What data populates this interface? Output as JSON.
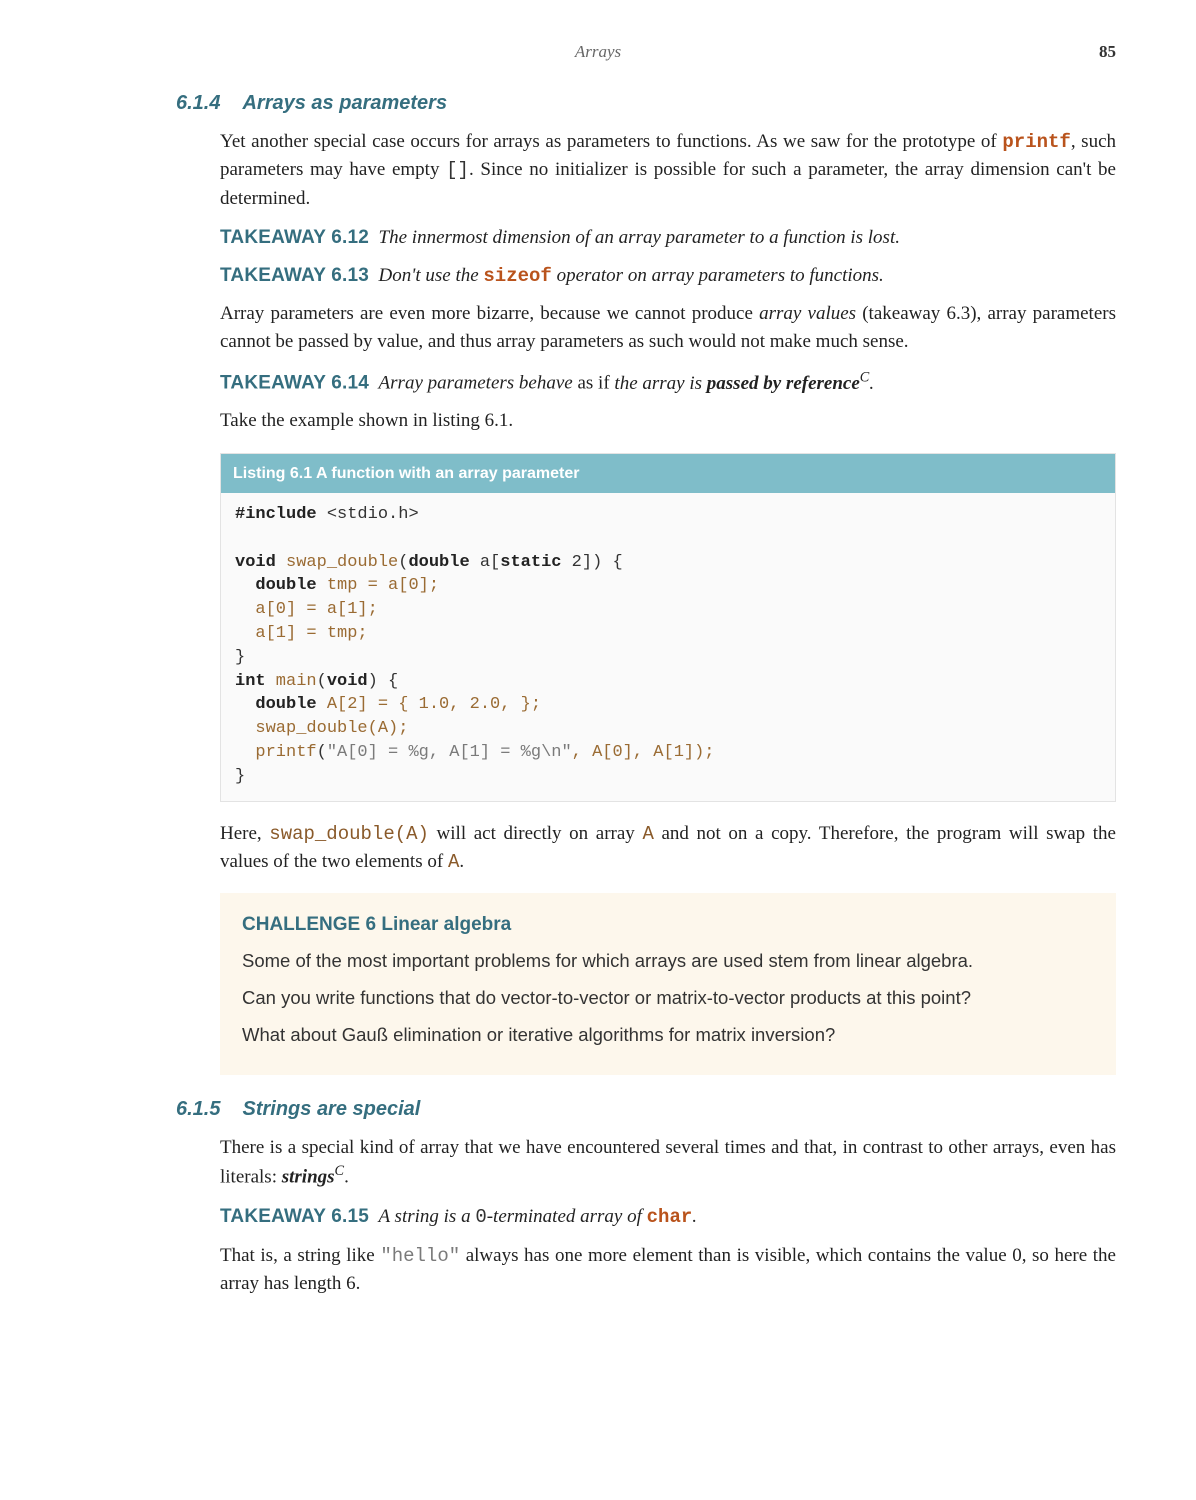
{
  "header": {
    "title": "Arrays",
    "page_number": "85"
  },
  "section1": {
    "num": "6.1.4",
    "title": "Arrays as parameters"
  },
  "p1a": "Yet another special case occurs for arrays as parameters to functions.  As we saw for the prototype of ",
  "p1_printf": "printf",
  "p1b": ", such parameters may have empty ",
  "p1_brackets": "[]",
  "p1c": ".  Since no initializer is possible for such a parameter, the array dimension can't be determined.",
  "tw612": {
    "label": "TAKEAWAY 6.12",
    "text": "The innermost dimension of an array parameter to a function is lost."
  },
  "tw613": {
    "label": "TAKEAWAY 6.13",
    "pre": "Don't use the ",
    "code": "sizeof",
    "post": " operator on array parameters to functions."
  },
  "p2": "Array parameters are even more bizarre, because we cannot produce ",
  "p2_em": "array values",
  "p2b": " (takeaway 6.3), array parameters cannot be passed by value, and thus array parameters as such would not make much sense.",
  "tw614": {
    "label": "TAKEAWAY 6.14",
    "pre": "Array parameters behave ",
    "mid": "as if",
    "mid2": " the array is ",
    "strong": "passed by reference",
    "sup": "C",
    "post": "."
  },
  "p3": "Take the example shown in listing 6.1.",
  "listing": {
    "title": "Listing 6.1   A function with an array parameter",
    "code": {
      "l1_kw": "#include",
      "l1_rest": " <stdio.h>",
      "l3_kw1": "void",
      "l3_fn": " swap_double",
      "l3_p1": "(",
      "l3_kw2": "double",
      "l3_p2": " a[",
      "l3_kw3": "static",
      "l3_p3": " 2]) {",
      "l4_kw": "  double",
      "l4_rest": " tmp = a[0];",
      "l5": "  a[0] = a[1];",
      "l6": "  a[1] = tmp;",
      "l7": "}",
      "l8_kw1": "int",
      "l8_fn": " main",
      "l8_p1": "(",
      "l8_kw2": "void",
      "l8_p2": ") {",
      "l9_kw": "  double",
      "l9_rest": " A[2] = { 1.0, 2.0, };",
      "l10_fn": "  swap_double",
      "l10_rest": "(A);",
      "l11_fn": "  printf",
      "l11_p1": "(",
      "l11_str": "\"A[0] = %g, A[1] = %g\\n\"",
      "l11_rest": ", A[0], A[1]);",
      "l12": "}"
    }
  },
  "p4a": "Here, ",
  "p4_code1": "swap_double(A)",
  "p4b": " will act directly on array ",
  "p4_code2": "A",
  "p4c": " and not on a copy.  Therefore, the program will swap the values of the two elements of ",
  "p4_code3": "A",
  "p4d": ".",
  "challenge": {
    "title": "CHALLENGE 6 Linear algebra",
    "p1": "Some of the most important problems for which arrays are used stem from linear algebra.",
    "p2": "Can you write functions that do vector-to-vector or matrix-to-vector products at this point?",
    "p3": "What about Gauß elimination or iterative algorithms for matrix inversion?"
  },
  "section2": {
    "num": "6.1.5",
    "title": "Strings are special"
  },
  "p5a": "There is a special kind of array that we have encountered several times and that, in contrast to other arrays, even has literals: ",
  "p5_strong": "strings",
  "p5_sup": "C",
  "p5b": ".",
  "tw615": {
    "label": "TAKEAWAY 6.15",
    "pre": "A string is a ",
    "zero": "0",
    "mid": "-terminated array of ",
    "code": "char",
    "post": "."
  },
  "p6a": "That is, a string like ",
  "p6_code": "\"hello\"",
  "p6b": " always has one more element than is visible, which contains the value ",
  "p6_zero": "0",
  "p6c": ", so here the array has length ",
  "p6_six": "6",
  "p6d": "."
}
